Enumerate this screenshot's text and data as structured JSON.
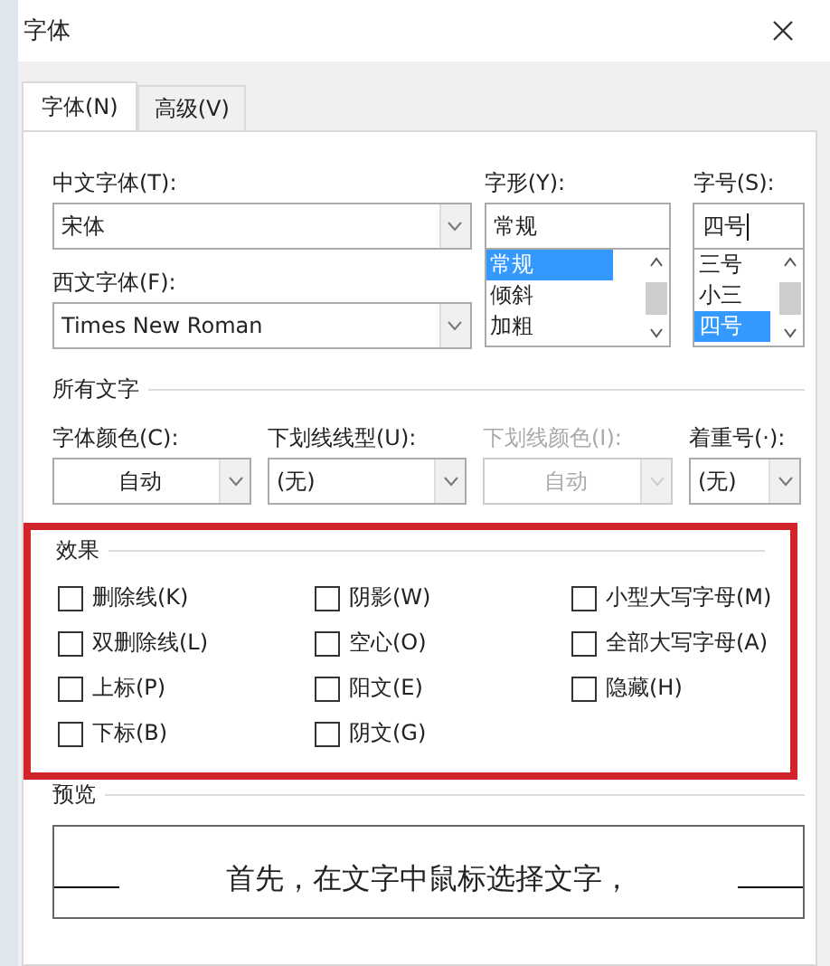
{
  "window": {
    "title": "字体"
  },
  "tabs": [
    {
      "label": "字体(N)",
      "selected": true
    },
    {
      "label": "高级(V)",
      "selected": false
    }
  ],
  "font": {
    "chinese": {
      "label": "中文字体(T):",
      "value": "宋体"
    },
    "western": {
      "label": "西文字体(F):",
      "value": "Times New Roman"
    },
    "style": {
      "label": "字形(Y):",
      "value": "常规",
      "options": [
        {
          "text": "常规",
          "selected": true
        },
        {
          "text": "倾斜",
          "selected": false
        },
        {
          "text": "加粗",
          "selected": false
        }
      ]
    },
    "size": {
      "label": "字号(S):",
      "value": "四号",
      "options": [
        {
          "text": "三号",
          "selected": false
        },
        {
          "text": "小三",
          "selected": false
        },
        {
          "text": "四号",
          "selected": true
        }
      ]
    }
  },
  "all_text": {
    "title": "所有文字",
    "fields": [
      {
        "label": "字体颜色(C):",
        "value": "自动",
        "disabled": false,
        "centered": true
      },
      {
        "label": "下划线线型(U):",
        "value": "(无)",
        "disabled": false,
        "centered": false
      },
      {
        "label": "下划线颜色(I):",
        "value": "自动",
        "disabled": true,
        "centered": true
      },
      {
        "label": "着重号(·):",
        "value": "(无)",
        "disabled": false,
        "centered": false
      }
    ]
  },
  "effects": {
    "title": "效果",
    "highlighted": true,
    "options": [
      {
        "label": "删除线(K)",
        "checked": false
      },
      {
        "label": "阴影(W)",
        "checked": false
      },
      {
        "label": "小型大写字母(M)",
        "checked": false
      },
      {
        "label": "双删除线(L)",
        "checked": false
      },
      {
        "label": "空心(O)",
        "checked": false
      },
      {
        "label": "全部大写字母(A)",
        "checked": false
      },
      {
        "label": "上标(P)",
        "checked": false
      },
      {
        "label": "阳文(E)",
        "checked": false
      },
      {
        "label": "隐藏(H)",
        "checked": false
      },
      {
        "label": "下标(B)",
        "checked": false
      },
      {
        "label": "阴文(G)",
        "checked": false
      }
    ]
  },
  "preview": {
    "title": "预览",
    "text": "首先，在文字中鼠标选择文字，"
  }
}
